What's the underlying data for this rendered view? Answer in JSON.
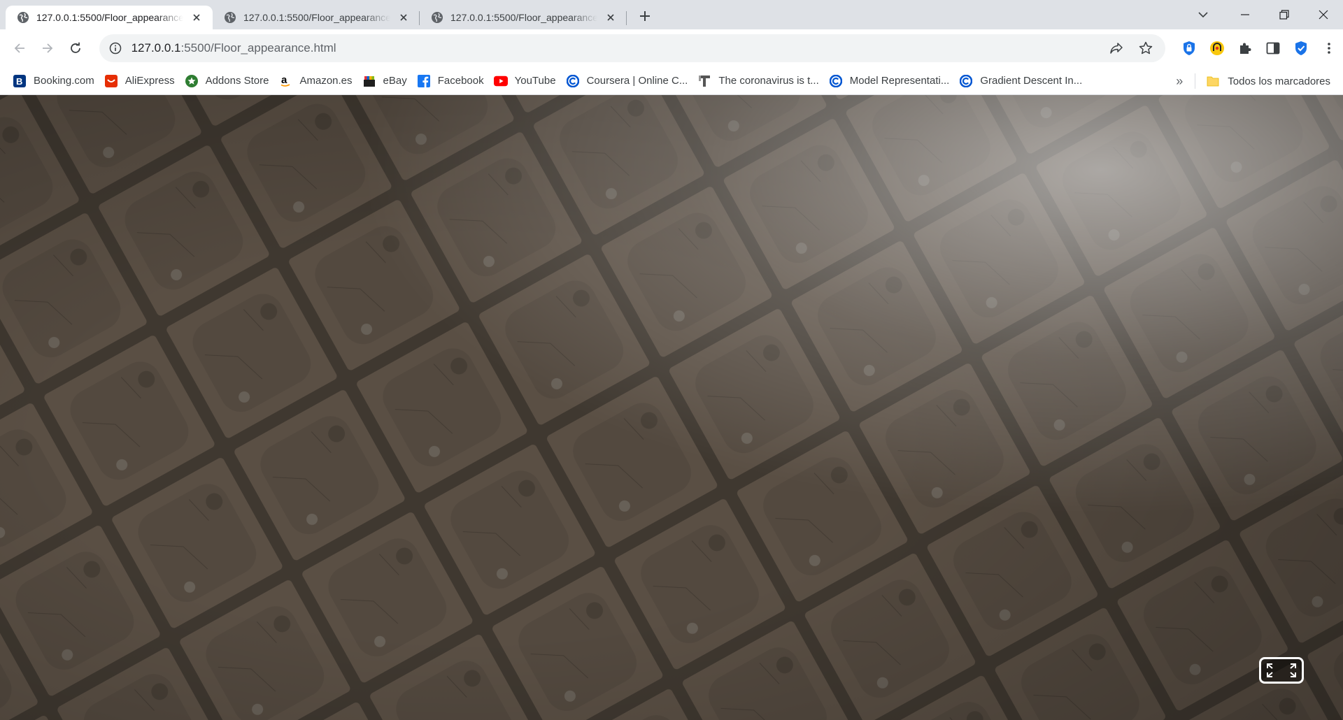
{
  "browser": {
    "tabs": [
      {
        "title": "127.0.0.1:5500/Floor_appearance.html",
        "active": true,
        "icon": "globe-icon"
      },
      {
        "title": "127.0.0.1:5500/Floor_appearance.html",
        "active": false,
        "icon": "globe-icon"
      },
      {
        "title": "127.0.0.1:5500/Floor_appearance.html",
        "active": false,
        "icon": "globe-icon"
      }
    ],
    "new_tab_icon": "plus-icon",
    "window_controls": [
      "tab-search-icon",
      "minimize-icon",
      "restore-icon",
      "close-icon"
    ]
  },
  "toolbar": {
    "url_host": "127.0.0.1",
    "url_path": ":5500/Floor_appearance.html",
    "omnibox_actions": [
      "share-icon",
      "star-icon"
    ],
    "extensions": [
      {
        "name": "password-manager-icon",
        "color": "#1a73e8"
      },
      {
        "name": "ad-blocker-icon",
        "color": "#f9c80e"
      },
      {
        "name": "puzzle-extensions-icon",
        "color": "#5f6368"
      },
      {
        "name": "side-panel-icon",
        "color": "#5f6368"
      },
      {
        "name": "shield-check-icon",
        "color": "#1a73e8"
      },
      {
        "name": "kebab-menu-icon",
        "color": "#5f6368"
      }
    ]
  },
  "bookmarks": {
    "items": [
      {
        "label": "Booking.com",
        "icon": "booking-icon",
        "color": "#003580"
      },
      {
        "label": "AliExpress",
        "icon": "aliexpress-icon",
        "color": "#e62e04"
      },
      {
        "label": "Addons Store",
        "icon": "addons-store-icon",
        "color": "#2e7d32"
      },
      {
        "label": "Amazon.es",
        "icon": "amazon-icon",
        "color": "#000000"
      },
      {
        "label": "eBay",
        "icon": "ebay-icon",
        "color": "#e53238"
      },
      {
        "label": "Facebook",
        "icon": "facebook-icon",
        "color": "#1877f2"
      },
      {
        "label": "YouTube",
        "icon": "youtube-icon",
        "color": "#ff0000"
      },
      {
        "label": "Coursera | Online C...",
        "icon": "coursera-icon",
        "color": "#0056d2"
      },
      {
        "label": "The coronavirus is t...",
        "icon": "news-icon",
        "color": "#555555"
      },
      {
        "label": "Model Representati...",
        "icon": "coursera-icon",
        "color": "#0056d2"
      },
      {
        "label": "Gradient Descent In...",
        "icon": "coursera-icon",
        "color": "#0056d2"
      }
    ],
    "overflow_label": "»",
    "all_bookmarks_label": "Todos los marcadores"
  },
  "page": {
    "scene": "floor-tiles",
    "fullscreen_icon": "expand-fullscreen-icon"
  }
}
